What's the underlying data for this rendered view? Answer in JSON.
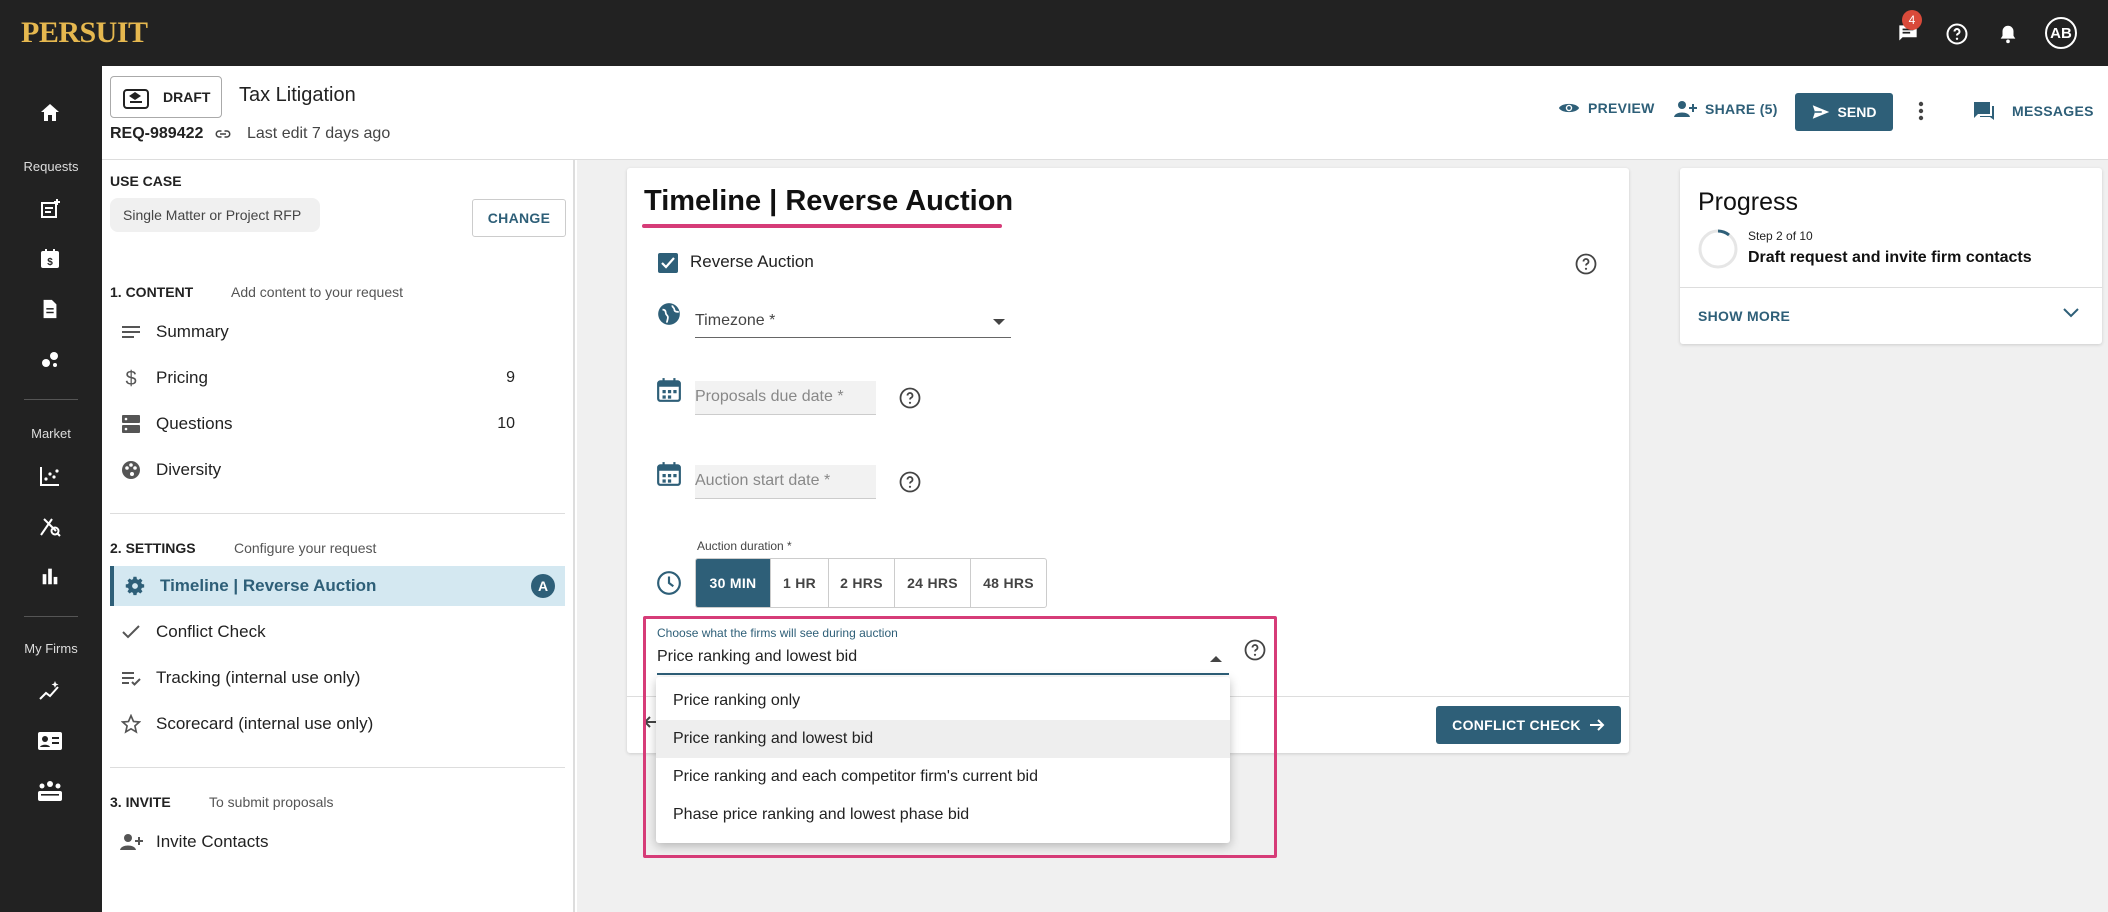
{
  "brand": {
    "logo": "PERSUIT"
  },
  "topbar": {
    "messages_count": "4",
    "avatar_initials": "AB"
  },
  "leftnav": {
    "sections": [
      {
        "label": "Requests"
      },
      {
        "label": "Market"
      },
      {
        "label": "My Firms"
      }
    ]
  },
  "header": {
    "status": "DRAFT",
    "title": "Tax Litigation",
    "request_id": "REQ-989422",
    "last_edit": "Last edit 7 days ago",
    "preview_label": "PREVIEW",
    "share_label": "SHARE (5)",
    "send_label": "SEND",
    "messages_label": "MESSAGES"
  },
  "sidebar": {
    "use_case_label": "USE CASE",
    "use_case_value": "Single Matter or Project RFP",
    "change_label": "CHANGE",
    "content": {
      "heading": "1. CONTENT",
      "subtitle": "Add content to your request",
      "items": [
        {
          "label": "Summary",
          "count": ""
        },
        {
          "label": "Pricing",
          "count": "9"
        },
        {
          "label": "Questions",
          "count": "10"
        },
        {
          "label": "Diversity",
          "count": ""
        }
      ]
    },
    "settings": {
      "heading": "2. SETTINGS",
      "subtitle": "Configure your request",
      "items": [
        {
          "label": "Timeline | Reverse Auction",
          "badge": "A"
        },
        {
          "label": "Conflict Check"
        },
        {
          "label": "Tracking (internal use only)"
        },
        {
          "label": "Scorecard (internal use only)"
        }
      ]
    },
    "invite": {
      "heading": "3. INVITE",
      "subtitle": "To submit proposals",
      "items": [
        {
          "label": "Invite Contacts"
        }
      ]
    }
  },
  "main": {
    "title": "Timeline | Reverse Auction",
    "reverse_auction_label": "Reverse Auction",
    "reverse_auction_checked": true,
    "timezone_label": "Timezone *",
    "proposals_due_placeholder": "Proposals due date *",
    "auction_start_placeholder": "Auction start date *",
    "duration_label": "Auction duration *",
    "durations": [
      "30 MIN",
      "1 HR",
      "2 HRS",
      "24 HRS",
      "48 HRS"
    ],
    "selected_duration": "30 MIN",
    "visibility": {
      "caption": "Choose what the firms will see during auction",
      "value": "Price ranking and lowest bid",
      "options": [
        "Price ranking only",
        "Price ranking and lowest bid",
        "Price ranking and each competitor firm's current bid",
        "Phase price ranking and lowest phase bid"
      ]
    },
    "next_button_label": "CONFLICT CHECK"
  },
  "progress": {
    "title": "Progress",
    "step": "Step 2 of 10",
    "description": "Draft request and invite firm contacts",
    "show_more_label": "SHOW MORE"
  },
  "colors": {
    "accent": "#2e5f78",
    "highlight": "#d63c78",
    "topbar": "#222222",
    "logo": "#e6b84f",
    "badge": "#d94a3a"
  }
}
